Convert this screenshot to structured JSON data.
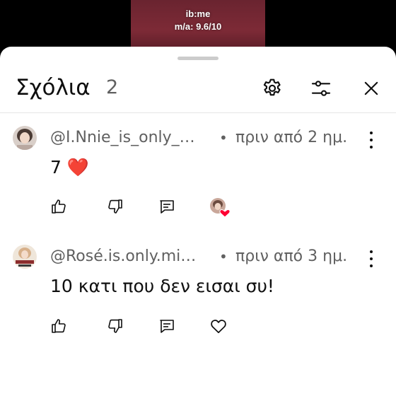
{
  "video_overlay": {
    "line1": "ib:me",
    "line2": "m/a: 9.6/10"
  },
  "panel": {
    "title": "Σχόλια",
    "count": "2"
  },
  "comments": [
    {
      "author": "@I.Nnie_is_only_…",
      "time": "πριν από 2 ημ.",
      "text": "7 ❤️",
      "creator_heart": true
    },
    {
      "author": "@Rosé.is.only.mi…",
      "time": "πριν από 3 ημ.",
      "text": "10 κατι που δεν εισαι συ!",
      "creator_heart": false
    }
  ],
  "colors": {
    "background": "#ffffff",
    "text_primary": "#0f0f0f",
    "text_secondary": "#606060",
    "heart_red": "#ff0033"
  },
  "icons": [
    "settings-icon",
    "filter-icon",
    "close-icon",
    "like-icon",
    "dislike-icon",
    "reply-icon",
    "heart-icon",
    "more-options-icon"
  ]
}
